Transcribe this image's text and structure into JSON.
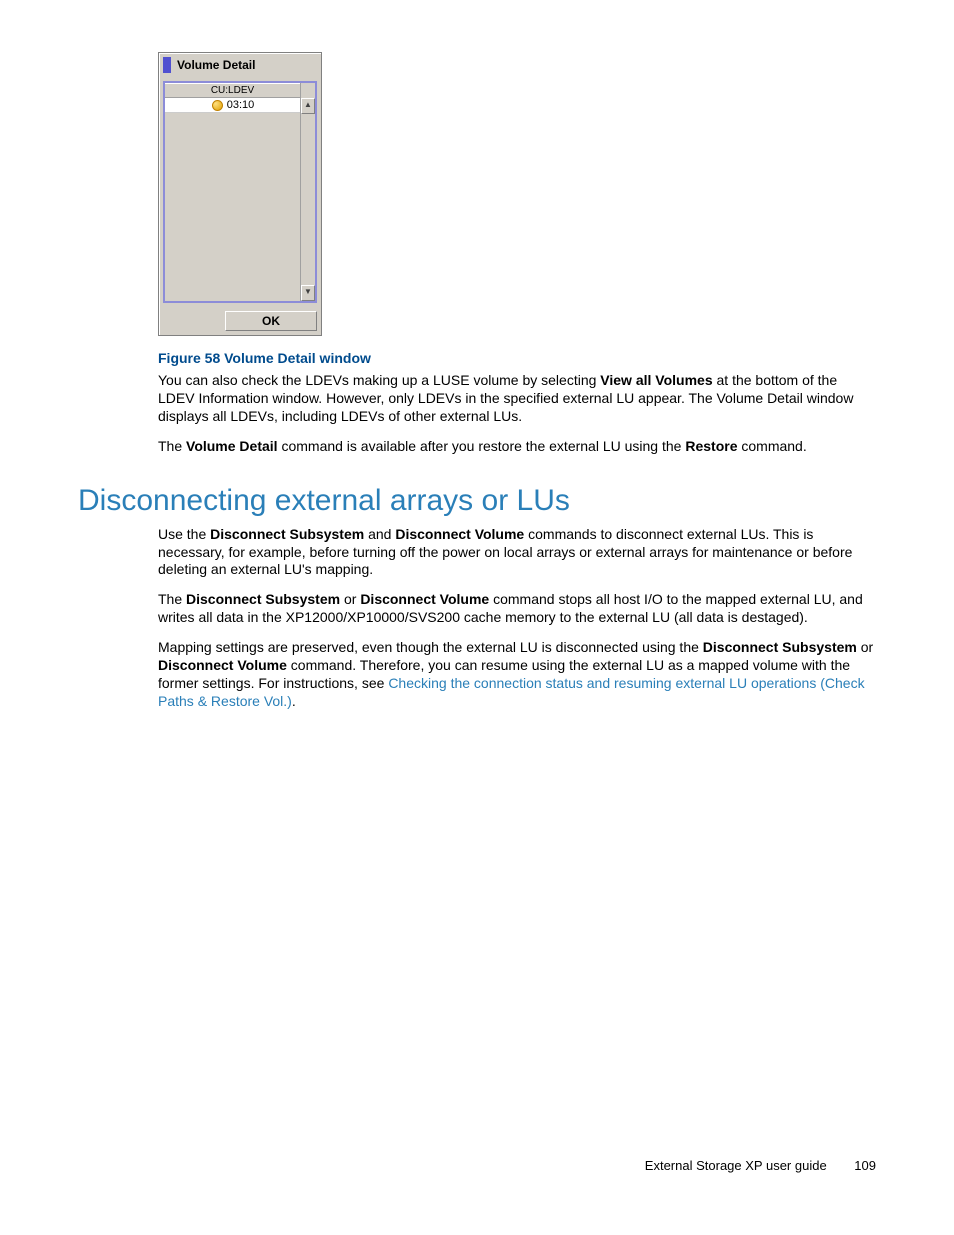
{
  "dialog": {
    "title": "Volume Detail",
    "header": "CU:LDEV",
    "row": "03:10",
    "ok": "OK"
  },
  "caption": "Figure 58 Volume Detail window",
  "para1": {
    "t1": "You can also check the LDEVs making up a LUSE volume by selecting ",
    "b1": "View all Volumes",
    "t2": " at the bottom of the LDEV Information window. However, only LDEVs in the specified external LU appear. The Volume Detail window displays all LDEVs, including LDEVs of other external LUs."
  },
  "para2": {
    "t1": "The ",
    "b1": "Volume Detail",
    "t2": " command is available after you restore the external LU using the ",
    "b2": "Restore",
    "t3": " command."
  },
  "heading": "Disconnecting external arrays or LUs",
  "para3": {
    "t1": "Use the ",
    "b1": "Disconnect Subsystem",
    "t2": " and ",
    "b2": "Disconnect Volume",
    "t3": " commands to disconnect external LUs. This is necessary, for example, before turning off the power on local arrays or external arrays for maintenance or before deleting an external LU's mapping."
  },
  "para4": {
    "t1": "The ",
    "b1": "Disconnect Subsystem",
    "t2": " or ",
    "b2": "Disconnect Volume",
    "t3": " command stops all host I/O to the mapped external LU, and writes all data in the XP12000/XP10000/SVS200 cache memory to the external LU (all data is destaged)."
  },
  "para5": {
    "t1": "Mapping settings are preserved, even though the external LU is disconnected using the ",
    "b1": "Disconnect Subsystem",
    "t2": " or ",
    "b2": "Disconnect Volume",
    "t3": " command. Therefore, you can resume using the external LU as a mapped volume with the former settings. For instructions, see ",
    "link": "Checking the connection status and resuming external LU operations (Check Paths & Restore Vol.)",
    "t4": "."
  },
  "footer": {
    "label": "External Storage XP user guide",
    "page": "109"
  }
}
